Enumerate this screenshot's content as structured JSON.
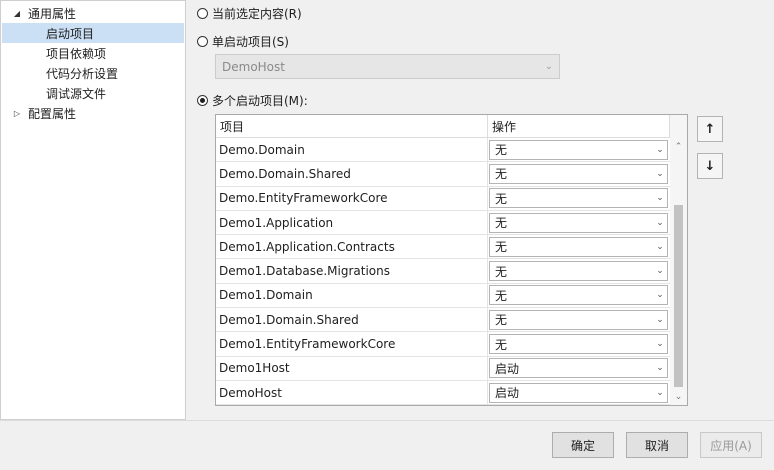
{
  "tree": {
    "items": [
      {
        "label": "通用属性",
        "toggle": "◢",
        "level": 0
      },
      {
        "label": "启动项目",
        "toggle": "",
        "level": 1,
        "selected": true
      },
      {
        "label": "项目依赖项",
        "toggle": "",
        "level": 1
      },
      {
        "label": "代码分析设置",
        "toggle": "",
        "level": 1
      },
      {
        "label": "调试源文件",
        "toggle": "",
        "level": 1
      },
      {
        "label": "配置属性",
        "toggle": "▷",
        "level": 0
      }
    ]
  },
  "options": {
    "current_selection": "当前选定内容(R)",
    "single_startup": "单启动项目(S)",
    "single_startup_value": "DemoHost",
    "multiple_startup": "多个启动项目(M):",
    "selected": "multiple"
  },
  "grid": {
    "col_project": "项目",
    "col_action": "操作",
    "rows": [
      {
        "project": "Demo.Domain",
        "action": "无"
      },
      {
        "project": "Demo.Domain.Shared",
        "action": "无"
      },
      {
        "project": "Demo.EntityFrameworkCore",
        "action": "无"
      },
      {
        "project": "Demo1.Application",
        "action": "无"
      },
      {
        "project": "Demo1.Application.Contracts",
        "action": "无"
      },
      {
        "project": "Demo1.Database.Migrations",
        "action": "无"
      },
      {
        "project": "Demo1.Domain",
        "action": "无"
      },
      {
        "project": "Demo1.Domain.Shared",
        "action": "无"
      },
      {
        "project": "Demo1.EntityFrameworkCore",
        "action": "无"
      },
      {
        "project": "Demo1Host",
        "action": "启动"
      },
      {
        "project": "DemoHost",
        "action": "启动"
      }
    ]
  },
  "icons": {
    "move_up": "↑",
    "move_down": "↓",
    "dropdown": "⌄",
    "scroll_up": "⌃",
    "scroll_down": "⌄"
  },
  "buttons": {
    "ok": "确定",
    "cancel": "取消",
    "apply": "应用(A)"
  }
}
